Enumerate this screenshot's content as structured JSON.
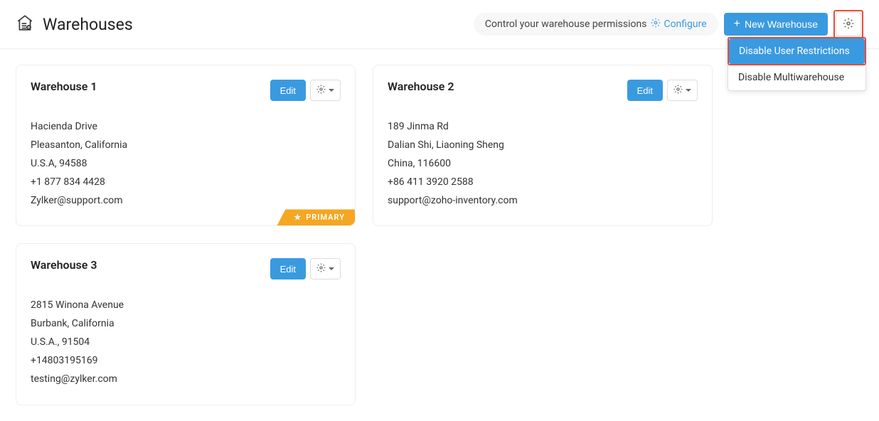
{
  "header": {
    "title": "Warehouses",
    "permissions_text": "Control your warehouse permissions",
    "configure_label": "Configure",
    "new_warehouse_label": "New Warehouse"
  },
  "dropdown": {
    "item1": "Disable User Restrictions",
    "item2": "Disable Multiwarehouse"
  },
  "common": {
    "edit_label": "Edit",
    "primary_label": "PRIMARY"
  },
  "warehouses": [
    {
      "name": "Warehouse 1",
      "street": "Hacienda Drive",
      "city": "Pleasanton, California",
      "country": "U.S.A, 94588",
      "phone": "+1 877 834 4428",
      "email": "Zylker@support.com",
      "primary": true
    },
    {
      "name": "Warehouse 2",
      "street": "189 Jinma Rd",
      "city": "Dalian Shi, Liaoning Sheng",
      "country": "China, 116600",
      "phone": "+86 411 3920 2588",
      "email": "support@zoho-inventory.com",
      "primary": false
    },
    {
      "name": "Warehouse 3",
      "street": "2815 Winona Avenue",
      "city": "Burbank, California",
      "country": "U.S.A., 91504",
      "phone": "+14803195169",
      "email": "testing@zylker.com",
      "primary": false
    }
  ]
}
